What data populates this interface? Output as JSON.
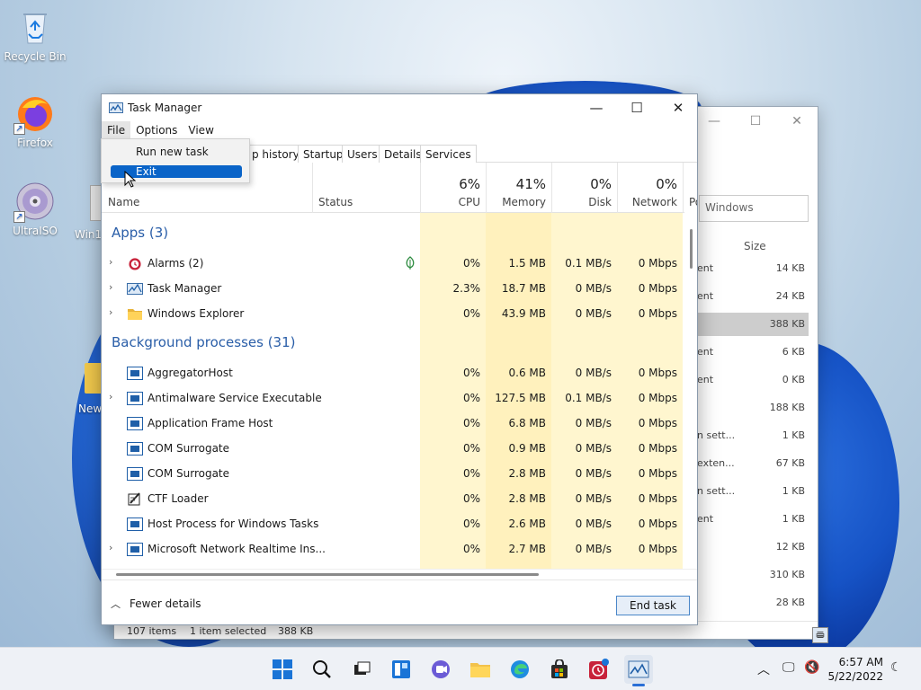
{
  "desktop": {
    "icons": [
      {
        "label": "Recycle Bin"
      },
      {
        "label": "Firefox"
      },
      {
        "label": "UltraISO"
      },
      {
        "label": "Win1"
      },
      {
        "label": "New"
      }
    ]
  },
  "explorer": {
    "search_placeholder": "Windows",
    "size_header": "Size",
    "rows": [
      {
        "type": "ent",
        "size": "14 KB"
      },
      {
        "type": "ent",
        "size": "24 KB"
      },
      {
        "type": "",
        "size": "388 KB"
      },
      {
        "type": "ent",
        "size": "6 KB"
      },
      {
        "type": "ent",
        "size": "0 KB"
      },
      {
        "type": "",
        "size": "188 KB"
      },
      {
        "type": "n sett...",
        "size": "1 KB"
      },
      {
        "type": "exten...",
        "size": "67 KB"
      },
      {
        "type": "n sett...",
        "size": "1 KB"
      },
      {
        "type": "ent",
        "size": "1 KB"
      },
      {
        "type": "",
        "size": "12 KB"
      },
      {
        "type": "",
        "size": "310 KB"
      },
      {
        "type": "",
        "size": "28 KB"
      }
    ],
    "status": {
      "items": "107 items",
      "selected": "1 item selected",
      "size": "388 KB"
    }
  },
  "task_manager": {
    "title": "Task Manager",
    "menu": [
      "File",
      "Options",
      "View"
    ],
    "file_menu": [
      "Run new task",
      "Exit"
    ],
    "tabs": [
      "p history",
      "Startup",
      "Users",
      "Details",
      "Services"
    ],
    "columns": {
      "name": "Name",
      "status": "Status",
      "cpu": {
        "pct": "6%",
        "label": "CPU"
      },
      "memory": {
        "pct": "41%",
        "label": "Memory"
      },
      "disk": {
        "pct": "0%",
        "label": "Disk"
      },
      "network": {
        "pct": "0%",
        "label": "Network"
      },
      "power": "Po"
    },
    "groups": {
      "apps": "Apps (3)",
      "background": "Background processes (31)"
    },
    "apps": [
      {
        "name": "Alarms (2)",
        "cpu": "0%",
        "mem": "1.5 MB",
        "disk": "0.1 MB/s",
        "net": "0 Mbps",
        "icon": "alarm-icon",
        "expandable": true
      },
      {
        "name": "Task Manager",
        "cpu": "2.3%",
        "mem": "18.7 MB",
        "disk": "0 MB/s",
        "net": "0 Mbps",
        "icon": "task-manager-icon",
        "expandable": true
      },
      {
        "name": "Windows Explorer",
        "cpu": "0%",
        "mem": "43.9 MB",
        "disk": "0 MB/s",
        "net": "0 Mbps",
        "icon": "folder-icon",
        "expandable": true
      }
    ],
    "background": [
      {
        "name": "AggregatorHost",
        "cpu": "0%",
        "mem": "0.6 MB",
        "disk": "0 MB/s",
        "net": "0 Mbps",
        "expandable": false
      },
      {
        "name": "Antimalware Service Executable",
        "cpu": "0%",
        "mem": "127.5 MB",
        "disk": "0.1 MB/s",
        "net": "0 Mbps",
        "expandable": true
      },
      {
        "name": "Application Frame Host",
        "cpu": "0%",
        "mem": "6.8 MB",
        "disk": "0 MB/s",
        "net": "0 Mbps",
        "expandable": false
      },
      {
        "name": "COM Surrogate",
        "cpu": "0%",
        "mem": "0.9 MB",
        "disk": "0 MB/s",
        "net": "0 Mbps",
        "expandable": false
      },
      {
        "name": "COM Surrogate",
        "cpu": "0%",
        "mem": "2.8 MB",
        "disk": "0 MB/s",
        "net": "0 Mbps",
        "expandable": false
      },
      {
        "name": "CTF Loader",
        "cpu": "0%",
        "mem": "2.8 MB",
        "disk": "0 MB/s",
        "net": "0 Mbps",
        "expandable": false
      },
      {
        "name": "Host Process for Windows Tasks",
        "cpu": "0%",
        "mem": "2.6 MB",
        "disk": "0 MB/s",
        "net": "0 Mbps",
        "expandable": false
      },
      {
        "name": "Microsoft Network Realtime Ins...",
        "cpu": "0%",
        "mem": "2.7 MB",
        "disk": "0 MB/s",
        "net": "0 Mbps",
        "expandable": true
      }
    ],
    "fewer_details": "Fewer details",
    "end_task": "End task"
  },
  "taskbar": {
    "time": "6:57 AM",
    "date": "5/22/2022"
  },
  "colors": {
    "accent": "#0a64c8",
    "group_heading": "#2a5ea8",
    "heat_column": "#fff4c4"
  }
}
